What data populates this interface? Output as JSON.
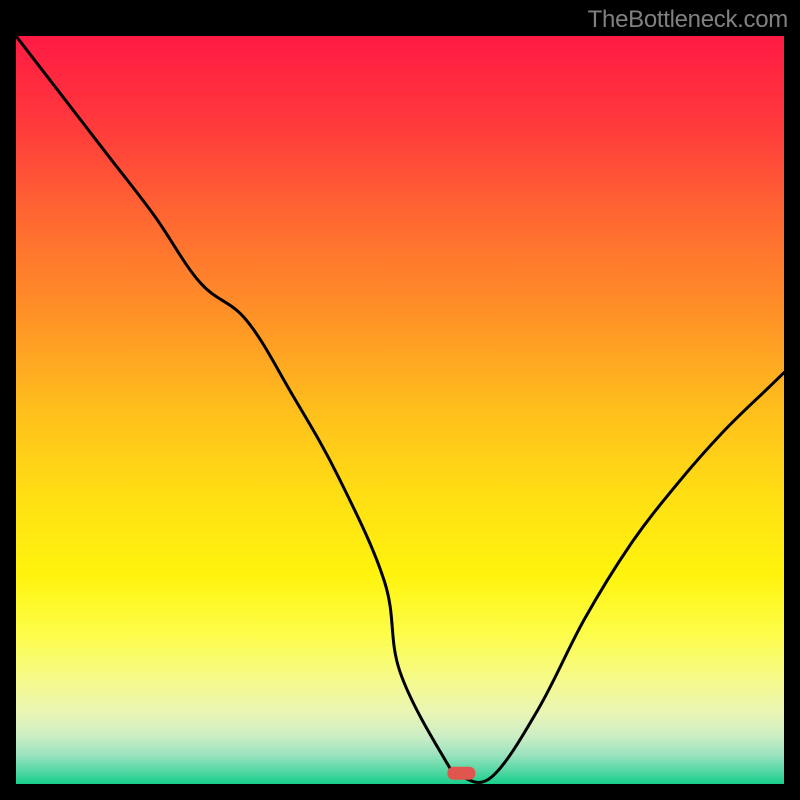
{
  "attribution": "TheBottleneck.com",
  "chart_data": {
    "type": "line",
    "title": "",
    "xlabel": "",
    "ylabel": "",
    "xlim": [
      0,
      100
    ],
    "ylim": [
      0,
      100
    ],
    "series": [
      {
        "name": "curve",
        "x": [
          0,
          6,
          12,
          18,
          24,
          30,
          36,
          42,
          48,
          50,
          56,
          58,
          62,
          68,
          74,
          80,
          86,
          92,
          98,
          100
        ],
        "values": [
          100,
          92,
          84,
          76,
          67,
          62,
          52,
          41,
          27,
          15,
          3,
          1,
          1,
          10,
          22,
          32,
          40,
          47,
          53,
          55
        ]
      }
    ],
    "marker": {
      "x": 58,
      "y": 1.5
    },
    "background_gradient": {
      "stops": [
        {
          "offset": 0.0,
          "color": "#ff1a43"
        },
        {
          "offset": 0.12,
          "color": "#ff3a3c"
        },
        {
          "offset": 0.25,
          "color": "#ff6a31"
        },
        {
          "offset": 0.38,
          "color": "#ff9426"
        },
        {
          "offset": 0.5,
          "color": "#ffbf1c"
        },
        {
          "offset": 0.62,
          "color": "#ffe013"
        },
        {
          "offset": 0.72,
          "color": "#fff40d"
        },
        {
          "offset": 0.8,
          "color": "#fdfd4a"
        },
        {
          "offset": 0.86,
          "color": "#f6fa8a"
        },
        {
          "offset": 0.905,
          "color": "#e9f5b5"
        },
        {
          "offset": 0.935,
          "color": "#cdeec4"
        },
        {
          "offset": 0.96,
          "color": "#9ee3c0"
        },
        {
          "offset": 0.985,
          "color": "#4cd6a0"
        },
        {
          "offset": 1.0,
          "color": "#18cf8a"
        }
      ]
    }
  }
}
